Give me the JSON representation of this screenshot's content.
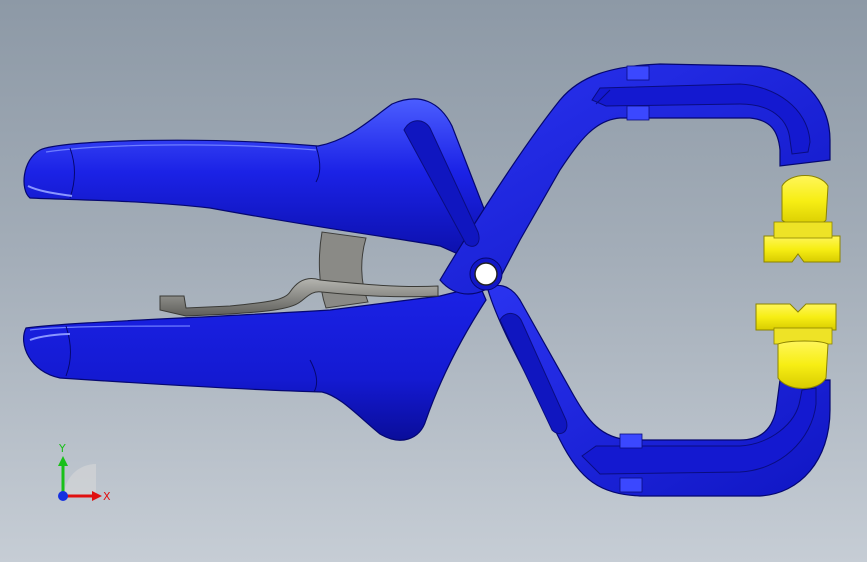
{
  "viewport": {
    "background_top": "#8d99a6",
    "background_bottom": "#c6cdd5"
  },
  "model": {
    "body_color": "#1a1ee0",
    "body_dark": "#0a0d9a",
    "body_light": "#4a5cff",
    "pad_color": "#f7ee14",
    "pad_dark": "#c9bd00",
    "spring_color": "#7a7a78",
    "pivot_color": "#ffffff"
  },
  "triad": {
    "x_label": "X",
    "y_label": "Y",
    "x_color": "#e01010",
    "y_color": "#19c019",
    "z_color": "#1530e0",
    "icons": [
      "x-axis-arrow-icon",
      "y-axis-arrow-icon",
      "z-axis-dot-icon"
    ]
  }
}
